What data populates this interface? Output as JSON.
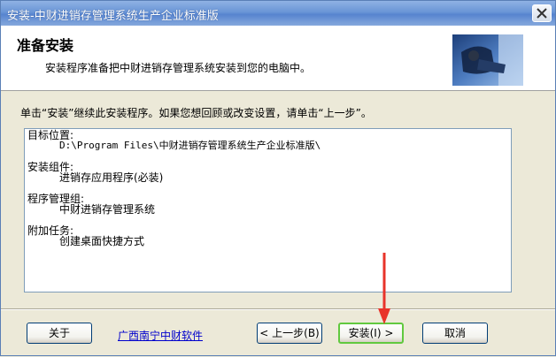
{
  "window": {
    "title": "安装-中财进销存管理系统生产企业标准版"
  },
  "header": {
    "title": "准备安装",
    "subtitle": "安装程序准备把中财进销存管理系统安装到您的电脑中。"
  },
  "instruction": "单击“安装”继续此安装程序。如果您想回顾或改变设置，请单击“上一步”。",
  "memo": {
    "target_label": "目标位置:",
    "target_value": "D:\\Program Files\\中财进销存管理系统生产企业标准版\\",
    "components_label": "安装组件:",
    "components_value": "进销存应用程序(必装)",
    "group_label": "程序管理组:",
    "group_value": "中财进销存管理系统",
    "tasks_label": "附加任务:",
    "tasks_value": "创建桌面快捷方式"
  },
  "buttons": {
    "about": "关于",
    "back": "< 上一步(B)",
    "install": "安装(I) >",
    "cancel": "取消"
  },
  "link": "广西南宁中财软件",
  "colors": {
    "arrow": "#e8332a",
    "link": "#0000cc",
    "default_button_border": "#61c93f"
  }
}
